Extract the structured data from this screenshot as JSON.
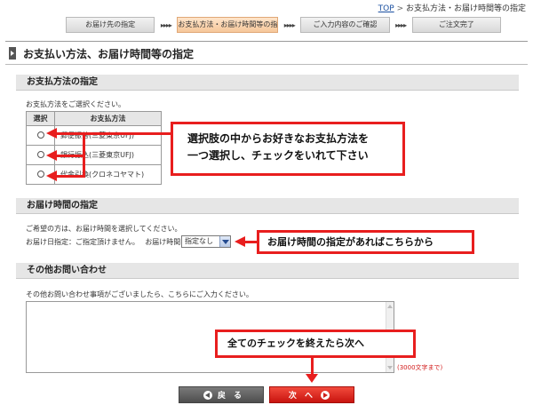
{
  "breadcrumb": {
    "top": "TOP",
    "separator": ">",
    "current": "お支払方法・お届け時間等の指定"
  },
  "steps": [
    {
      "label": "お届け先の指定"
    },
    {
      "label": "お支払方法・お届け時間等の指定",
      "active": true
    },
    {
      "label": "ご入力内容のご確認"
    },
    {
      "label": "ご注文完了"
    }
  ],
  "step_arrow": "▸▸▸▸",
  "page_title": "お支払い方法、お届け時間等の指定",
  "payment": {
    "heading": "お支払方法の指定",
    "instruction": "お支払方法をご選択ください。",
    "col_select": "選択",
    "col_method": "お支払方法",
    "methods": [
      "郵便振替(三菱東京UFJ)",
      "銀行振込(三菱東京UFJ)",
      "代金引換(クロネコヤマト)"
    ]
  },
  "delivery": {
    "heading": "お届け時間の指定",
    "instruction": "ご希望の方は、お届け時間を選択してください。",
    "date_label": "お届け日指定：ご指定頂けません。",
    "time_label": "お届け時間:",
    "time_selected": "指定なし"
  },
  "inquiry": {
    "heading": "その他お問い合わせ",
    "instruction": "その他お問い合わせ事項がございましたら、こちらにご入力ください。",
    "limit": "(3000文字まで)"
  },
  "callouts": {
    "payment_line1": "選択肢の中からお好きなお支払方法を",
    "payment_line2": "一つ選択し、チェックをいれて下さい",
    "delivery": "お届け時間の指定があればこちらから",
    "next": "全てのチェックを終えたら次へ"
  },
  "buttons": {
    "back": "戻 る",
    "next": "次 へ"
  },
  "colors": {
    "accent_red": "#e81e1e",
    "active_step": "#f6c79a",
    "section_bg": "#e6e6e6"
  }
}
